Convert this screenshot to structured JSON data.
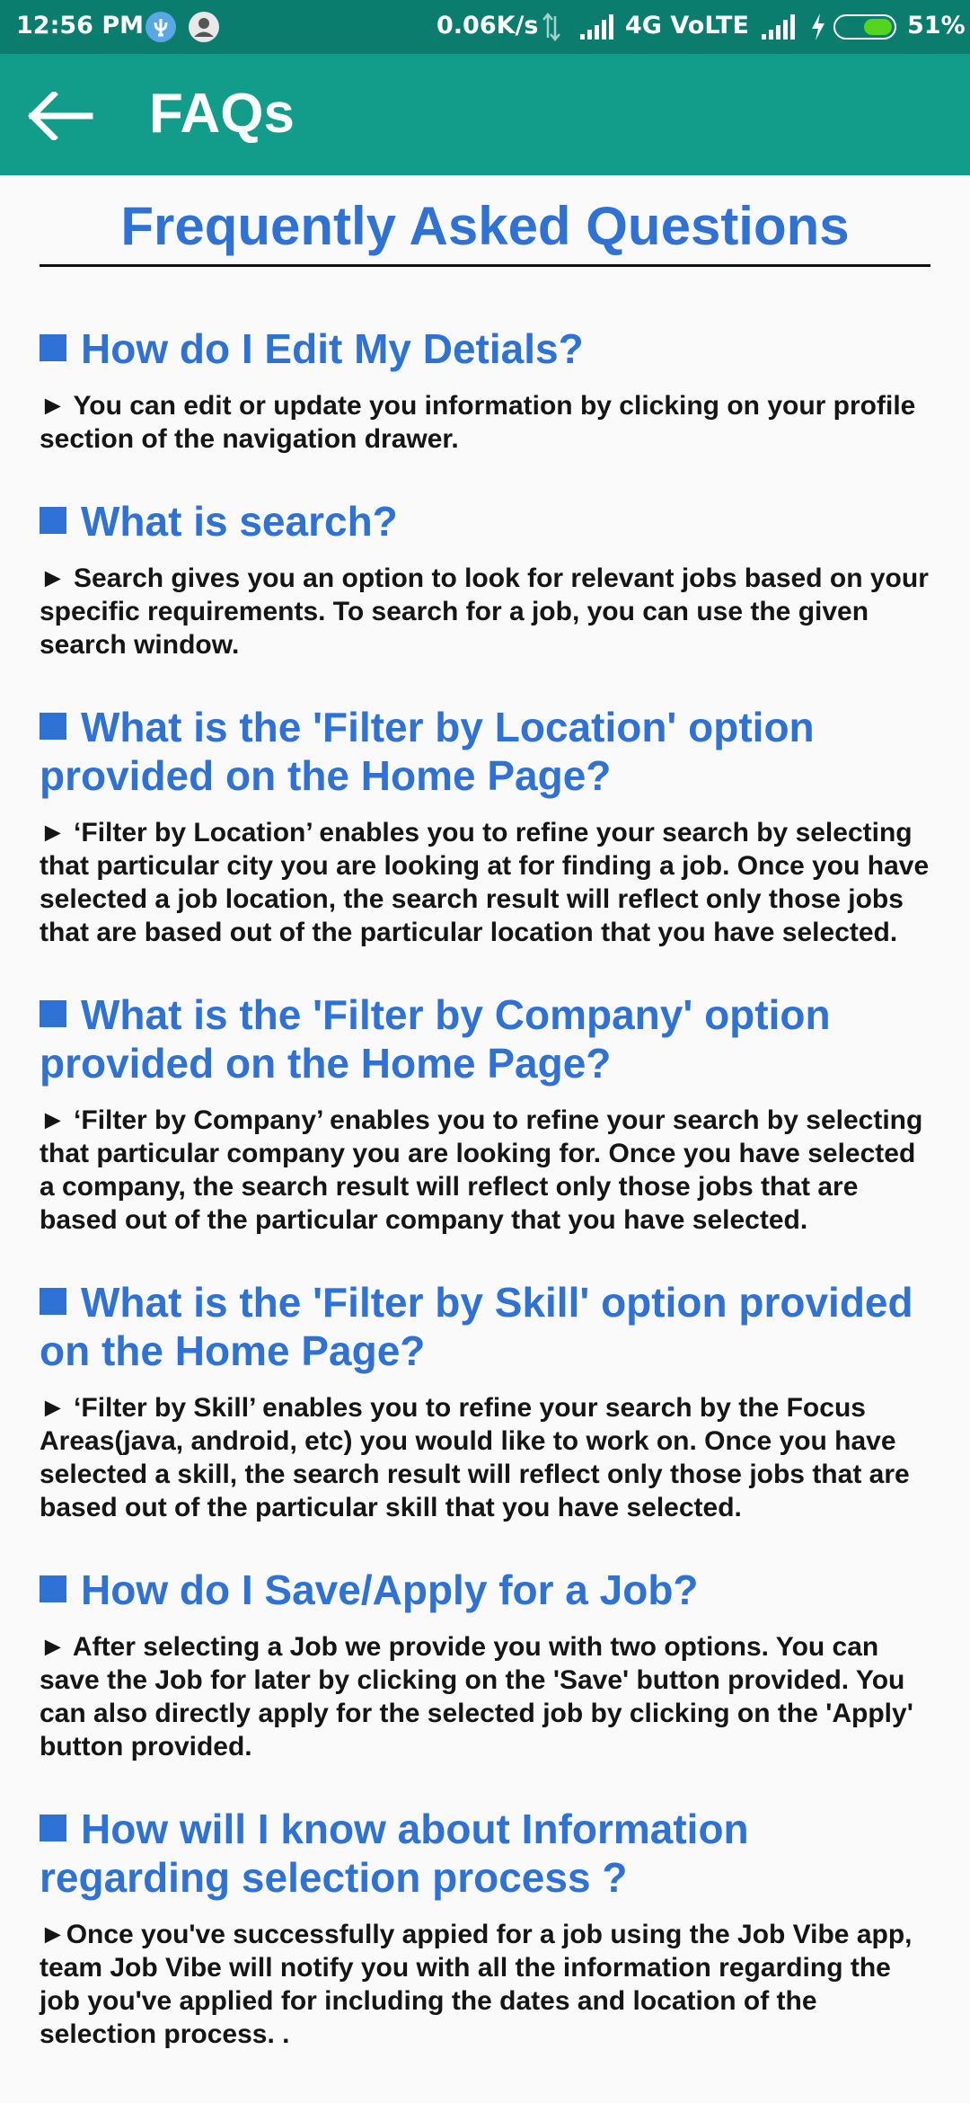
{
  "status_bar": {
    "time": "12:56 PM",
    "speed": "0.06K/s",
    "network": "4G VoLTE",
    "battery": "51%",
    "battery_level": 0.51,
    "icons": [
      "vpn-icon",
      "notification-icon",
      "data-transfer-icon",
      "signal-icon",
      "charging-icon",
      "battery-icon"
    ]
  },
  "app_bar": {
    "title": "FAQs",
    "back_icon": "arrow-left-icon",
    "background": "#129d8b"
  },
  "page": {
    "heading": "Frequently Asked Questions",
    "accent": "#2f72d6"
  },
  "faqs": [
    {
      "question": "How do I Edit My Detials?",
      "answer": "► You can edit or update you information by clicking on your profile section of the navigation drawer."
    },
    {
      "question": "What is search?",
      "answer": "► Search gives you an option to look for relevant jobs based on your specific requirements. To search for a job, you can use the given search window."
    },
    {
      "question": "What is the 'Filter by Location' option provided on the Home Page?",
      "answer": "► ‘Filter by Location’ enables you to refine your search by selecting that particular city you are looking at for finding a job. Once you have selected a job location, the search result will reflect only those jobs that are based out of the particular location that you have selected."
    },
    {
      "question": "What is the 'Filter by Company' option provided on the Home Page?",
      "answer": "► ‘Filter by Company’ enables you to refine your search by selecting that particular company you are looking for. Once you have selected a company, the search result will reflect only those jobs that are based out of the particular company that you have selected."
    },
    {
      "question": "What is the 'Filter by Skill' option provided on the Home Page?",
      "answer": "► ‘Filter by Skill’ enables you to refine your search by the Focus Areas(java, android, etc) you would like to work on. Once you have selected a skill, the search result will reflect only those jobs that are based out of the particular skill that you have selected."
    },
    {
      "question": "How do I Save/Apply for a Job?",
      "answer": "► After selecting a Job we provide you with two options. You can save the Job for later by clicking on the 'Save' button provided. You can also directly apply for the selected job by clicking on the 'Apply' button provided."
    },
    {
      "question": "How will I know about Information regarding selection process ?",
      "answer": "►Once you've successfully appied for a job using the Job Vibe app, team Job Vibe will notify you with all the information regarding the job you've applied for including the dates and location of the selection process. ."
    }
  ]
}
